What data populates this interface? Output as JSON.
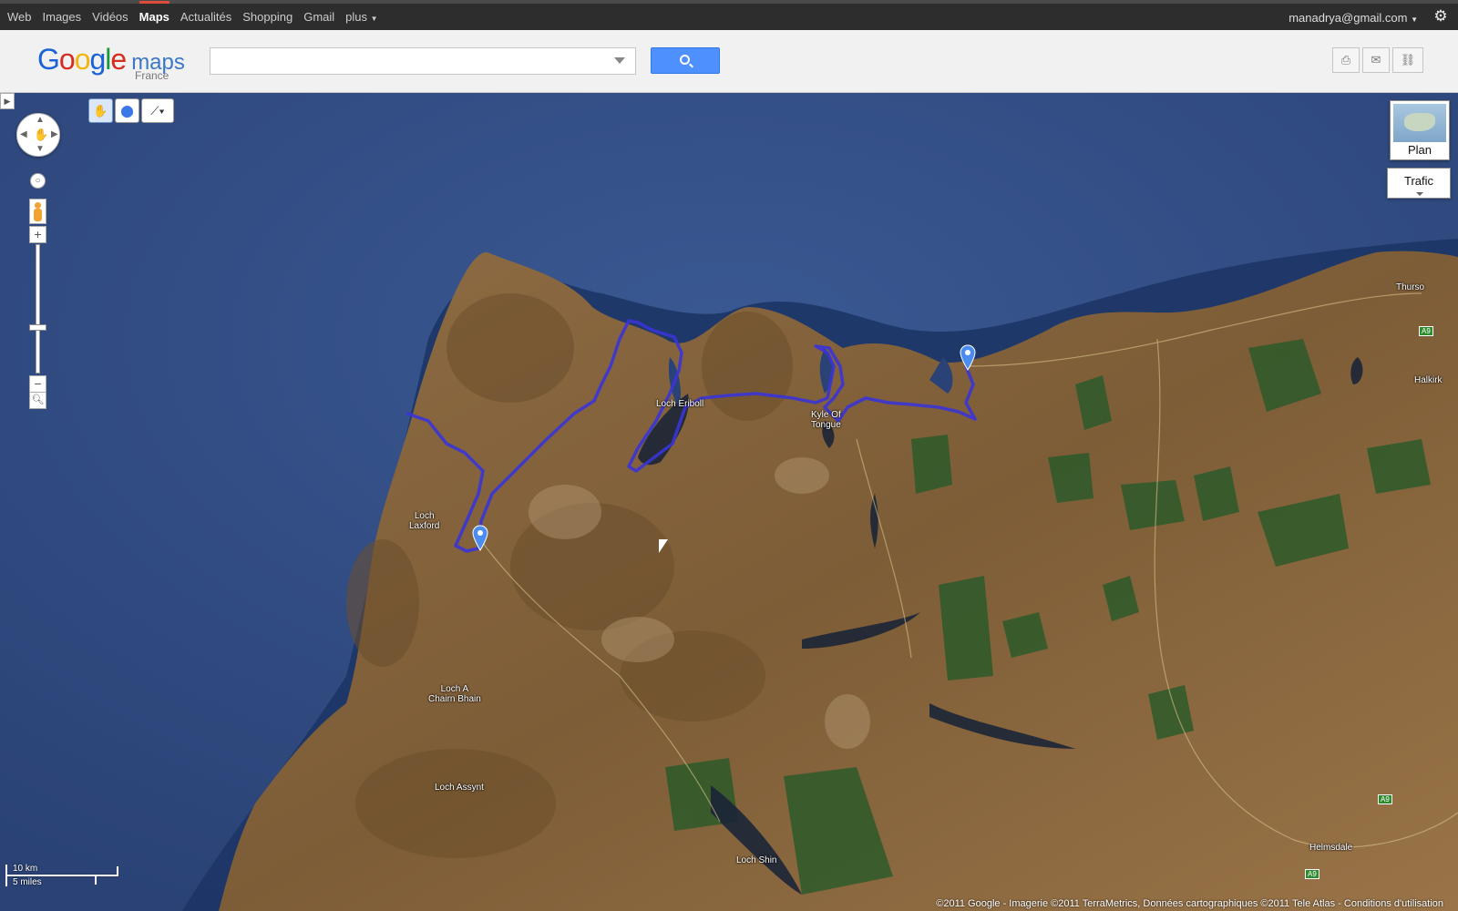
{
  "topbar": {
    "nav": [
      {
        "label": "Web",
        "active": false
      },
      {
        "label": "Images",
        "active": false
      },
      {
        "label": "Vidéos",
        "active": false
      },
      {
        "label": "Maps",
        "active": true
      },
      {
        "label": "Actualités",
        "active": false
      },
      {
        "label": "Shopping",
        "active": false
      },
      {
        "label": "Gmail",
        "active": false
      },
      {
        "label": "plus",
        "active": false
      }
    ],
    "account": "manadrya@gmail.com",
    "settings_icon": "gear-icon"
  },
  "header": {
    "logo_google": "Google",
    "logo_maps": "maps",
    "logo_region": "France",
    "search": {
      "value": "",
      "placeholder": ""
    },
    "search_icon": "search-icon",
    "actions": [
      "print-icon",
      "email-icon",
      "link-icon"
    ]
  },
  "map": {
    "imagery": "satellite",
    "place_labels": {
      "loch_eriboll": "Loch Eriboll",
      "kyle_of_tongue": "Kyle Of\nTongue",
      "loch_laxford": "Loch\nLaxford",
      "loch_a_chairn_bhain": "Loch A\nChairn Bhain",
      "loch_assynt": "Loch Assynt",
      "loch_shin": "Loch Shin",
      "thurso": "Thurso",
      "halkirk": "Halkirk",
      "helmsdale": "Helmsdale"
    },
    "road_labels": {
      "a9_1": "A9",
      "a9_2": "A9",
      "a9_3": "A9"
    },
    "route_color": "#3a34d6",
    "marker_color": "#4b8cf0",
    "water_color": "#2f4a7e",
    "land_color": "#8a6a3f",
    "controls": {
      "side_panel_toggle": "chevron-right-icon",
      "tools": [
        "hand-icon",
        "placemark-icon",
        "polyline-icon"
      ],
      "pan": "pan-control",
      "zoom_in": "+",
      "zoom_out": "−",
      "zoom_level_fraction": 0.35
    },
    "layers": {
      "plan_label": "Plan",
      "trafic_label": "Trafic"
    },
    "scale": {
      "km": "10 km",
      "miles": "5 miles"
    },
    "copyright": "©2011 Google - Imagerie ©2011 TerraMetrics, Données cartographiques ©2011 Tele Atlas - Conditions d'utilisation"
  }
}
